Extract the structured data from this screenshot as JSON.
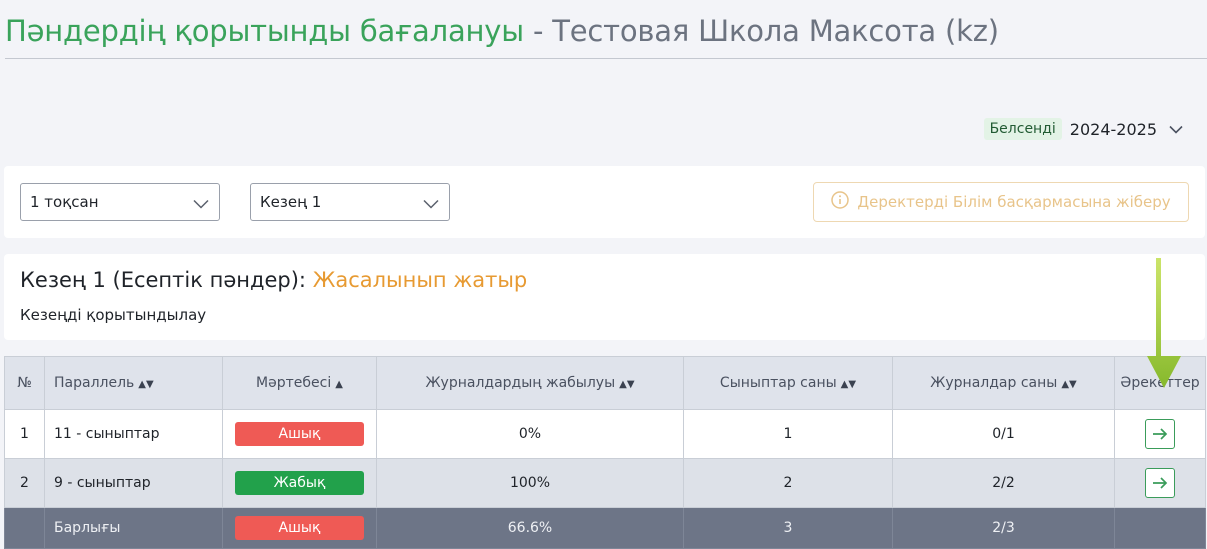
{
  "header": {
    "title_main": "Пәндердің қорытынды бағалануы",
    "title_sep": " - ",
    "title_school": "Тестовая Школа Максота (kz)"
  },
  "year": {
    "badge": "Белсенді",
    "value": "2024-2025"
  },
  "filters": {
    "quarter": "1 тоқсан",
    "period": "Кезең 1",
    "send_button": "Деректерді Білім басқармасына жіберу"
  },
  "status": {
    "label": "Кезең 1 (Есептік пәндер):",
    "state": "Жасалынып жатыр",
    "subtitle": "Кезеңді қорытындылау"
  },
  "table": {
    "headers": [
      "№",
      "Параллель",
      "Мәртебесі",
      "Журналдардың жабылуы",
      "Сыныптар саны",
      "Журналдар саны",
      "Әрекеттер"
    ],
    "rows": [
      {
        "num": "1",
        "parallel": "11 - сыныптар",
        "status": "Ашық",
        "closure": "0%",
        "classes": "1",
        "journals": "0/1"
      },
      {
        "num": "2",
        "parallel": "9 - сыныптар",
        "status": "Жабық",
        "closure": "100%",
        "classes": "2",
        "journals": "2/2"
      }
    ],
    "total": {
      "label": "Барлығы",
      "status": "Ашық",
      "closure": "66.6%",
      "classes": "3",
      "journals": "2/3"
    }
  },
  "colors": {
    "title_green": "#3aa35b",
    "status_orange": "#e79a32",
    "open_red": "#ef5a55",
    "closed_green": "#22a14b"
  }
}
